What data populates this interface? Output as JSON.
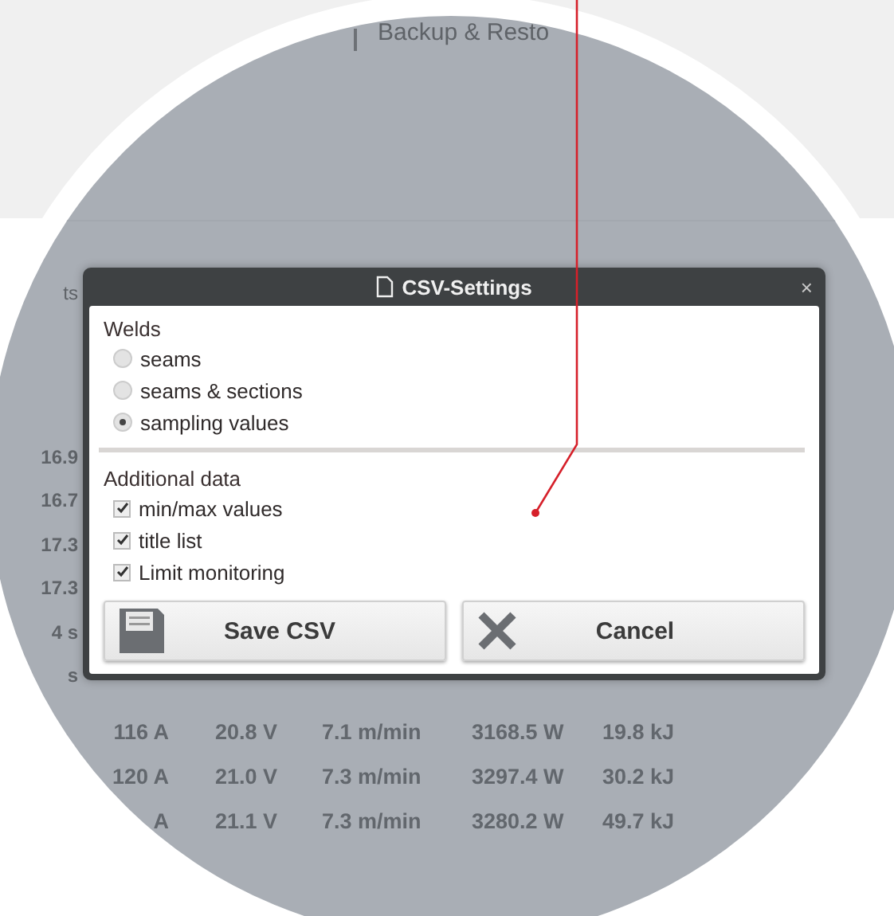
{
  "background_tab": {
    "label": "Backup & Resto"
  },
  "side_values": [
    "ts",
    "16.9",
    "16.7",
    "17.3",
    "17.3",
    "4 s",
    "s"
  ],
  "dialog": {
    "title": "CSV-Settings",
    "close": "×",
    "sections": [
      {
        "title": "Welds",
        "kind": "radio",
        "options": [
          {
            "label": "seams",
            "selected": false
          },
          {
            "label": "seams & sections",
            "selected": false
          },
          {
            "label": "sampling values",
            "selected": true
          }
        ]
      },
      {
        "title": "Additional data",
        "kind": "checkbox",
        "options": [
          {
            "label": "min/max values",
            "checked": true
          },
          {
            "label": "title list",
            "checked": true
          },
          {
            "label": "Limit monitoring",
            "checked": true
          }
        ]
      }
    ],
    "buttons": [
      {
        "label": "Save CSV",
        "kind": "save"
      },
      {
        "label": "Cancel",
        "kind": "cancel"
      }
    ]
  },
  "table": {
    "rows": [
      [
        "116 A",
        "20.8 V",
        "7.1 m/min",
        "3168.5 W",
        "19.8 kJ"
      ],
      [
        "120 A",
        "21.0 V",
        "7.3 m/min",
        "3297.4 W",
        "30.2 kJ"
      ],
      [
        "A",
        "21.1 V",
        "7.3 m/min",
        "3280.2 W",
        "49.7 kJ"
      ]
    ]
  }
}
